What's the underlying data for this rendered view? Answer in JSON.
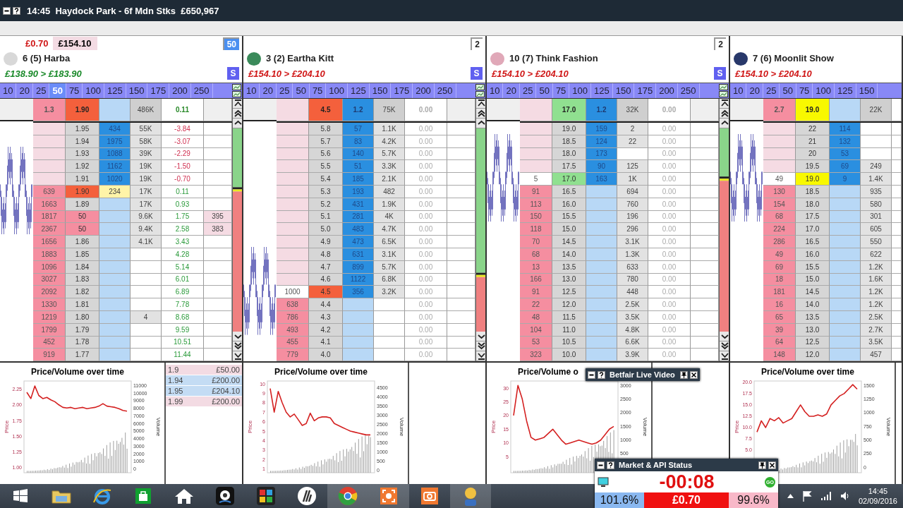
{
  "window": {
    "title": "14:45  Haydock Park - 6f Mdn Stks  £650,967"
  },
  "ladders": [
    {
      "profit": "£0.70",
      "liability": "£154.10",
      "stake_box": {
        "value": "50",
        "selected": true
      },
      "silk": {
        "color": "#d8d8d8"
      },
      "selection": "6  (5) Harba",
      "pl_range": "£138.90 > £183.90",
      "pl_positive": true,
      "s_button": "S",
      "cut": false,
      "highlight": {
        "color": "#f4603c"
      },
      "pl_active": true,
      "stakes": [
        {
          "label": "10",
          "selected": false
        },
        {
          "label": "20",
          "selected": false
        },
        {
          "label": "25",
          "selected": false
        },
        {
          "label": "50",
          "selected": true
        },
        {
          "label": "75",
          "selected": false
        },
        {
          "label": "100",
          "selected": false
        },
        {
          "label": "125",
          "selected": false
        },
        {
          "label": "150",
          "selected": false
        },
        {
          "label": "175",
          "selected": false
        },
        {
          "label": "200",
          "selected": false
        },
        {
          "label": "250",
          "selected": false
        }
      ],
      "summary": {
        "lay": "1.3",
        "ltp": "1.90",
        "traded": "486K",
        "pl": "0.11"
      },
      "rows": [
        {
          "kind": "back",
          "price": "1.95",
          "back": "434",
          "traded": "55K",
          "pl": "-3.84"
        },
        {
          "kind": "back",
          "price": "1.94",
          "back": "1975",
          "traded": "58K",
          "pl": "-3.07"
        },
        {
          "kind": "back",
          "price": "1.93",
          "back": "1088",
          "traded": "39K",
          "pl": "-2.29"
        },
        {
          "kind": "back",
          "price": "1.92",
          "back": "1162",
          "traded": "19K",
          "pl": "-1.50"
        },
        {
          "kind": "back",
          "price": "1.91",
          "back": "1020",
          "traded": "19K",
          "pl": "-0.70"
        },
        {
          "kind": "lay",
          "ltp": true,
          "hovered": true,
          "lay": "639",
          "price": "1.90",
          "back": "234",
          "traded": "17K",
          "pl": "0.11"
        },
        {
          "kind": "lay",
          "lay": "1663",
          "price": "1.89",
          "traded": "17K",
          "pl": "0.93"
        },
        {
          "kind": "lay",
          "order": true,
          "lay": "1817",
          "price": "50",
          "traded": "9.6K",
          "pl": "1.75",
          "extra": "395"
        },
        {
          "kind": "lay",
          "order": true,
          "lay": "2367",
          "price": "50",
          "traded": "9.4K",
          "pl": "2.58",
          "extra": "383"
        },
        {
          "kind": "lay",
          "lay": "1656",
          "price": "1.86",
          "traded": "4.1K",
          "pl": "3.43"
        },
        {
          "kind": "lay",
          "lay": "1883",
          "price": "1.85",
          "pl": "4.28"
        },
        {
          "kind": "lay",
          "lay": "1096",
          "price": "1.84",
          "pl": "5.14"
        },
        {
          "kind": "lay",
          "lay": "3027",
          "price": "1.83",
          "pl": "6.01"
        },
        {
          "kind": "lay",
          "lay": "2092",
          "price": "1.82",
          "pl": "6.89"
        },
        {
          "kind": "lay",
          "lay": "1330",
          "price": "1.81",
          "pl": "7.78"
        },
        {
          "kind": "lay",
          "lay": "1219",
          "price": "1.80",
          "traded": "4",
          "pl": "8.68"
        },
        {
          "kind": "lay",
          "lay": "1799",
          "price": "1.79",
          "pl": "9.59"
        },
        {
          "kind": "lay",
          "lay": "452",
          "price": "1.78",
          "pl": "10.51"
        },
        {
          "kind": "lay",
          "lay": "919",
          "price": "1.77",
          "pl": "11.44"
        }
      ],
      "orders": [
        {
          "price": "1.9",
          "amount": "£50.00",
          "kind": "lay"
        },
        {
          "price": "1.94",
          "amount": "£200.00",
          "kind": "back"
        },
        {
          "price": "1.95",
          "amount": "£204.10",
          "kind": "back"
        },
        {
          "price": "1.99",
          "amount": "£200.00",
          "kind": "lay"
        }
      ],
      "chart_data": {
        "type": "line",
        "title": "Price/Volume over time",
        "y2label": "Volume",
        "ylim": [
          0.92,
          2.38
        ],
        "yticks": [
          {
            "value": 1,
            "label": "1.00"
          },
          {
            "value": 1.25,
            "label": "1.25"
          },
          {
            "value": 1.5,
            "label": "1.50"
          },
          {
            "value": 1.75,
            "label": "1.75"
          },
          {
            "value": 2,
            "label": "2.00"
          },
          {
            "value": 2.25,
            "label": "2.25"
          }
        ],
        "y2lim": [
          -500,
          11600
        ],
        "y2ticks": [
          0,
          1000,
          2000,
          3000,
          4000,
          5000,
          6000,
          7000,
          8000,
          9000,
          10000,
          11000
        ],
        "series": [
          {
            "name": "Price",
            "color": "#d42020",
            "values": [
              2.2,
              2.1,
              2.3,
              2.15,
              2.1,
              2.12,
              2.08,
              2.05,
              2.0,
              1.96,
              1.95,
              1.96,
              1.94,
              1.95,
              1.96,
              1.94,
              1.95,
              1.96,
              1.98,
              2.02,
              1.98,
              1.97,
              1.96,
              1.94,
              1.91,
              1.9
            ]
          }
        ]
      }
    },
    {
      "stake_box": {
        "value": "2",
        "selected": false
      },
      "silk": {
        "color": "#3a8a5a"
      },
      "selection": "3  (2) Eartha Kitt",
      "pl_range": "£154.10 > £204.10",
      "pl_positive": false,
      "s_button": "S",
      "cut": false,
      "highlight": {
        "color": "#f4603c"
      },
      "pl_active": false,
      "stakes": [
        {
          "label": "10",
          "selected": false
        },
        {
          "label": "20",
          "selected": false
        },
        {
          "label": "25",
          "selected": false
        },
        {
          "label": "50",
          "selected": false
        },
        {
          "label": "75",
          "selected": false
        },
        {
          "label": "100",
          "selected": false
        },
        {
          "label": "125",
          "selected": false
        },
        {
          "label": "150",
          "selected": false
        },
        {
          "label": "175",
          "selected": false
        },
        {
          "label": "200",
          "selected": false
        },
        {
          "label": "250",
          "selected": false
        }
      ],
      "summary": {
        "ltp": "4.5",
        "back": "1.2",
        "traded": "75K",
        "pl": "0.00"
      },
      "rows": [
        {
          "kind": "back",
          "price": "5.8",
          "back": "57",
          "traded": "1.1K",
          "pl": "0.00"
        },
        {
          "kind": "back",
          "price": "5.7",
          "back": "83",
          "traded": "4.2K",
          "pl": "0.00"
        },
        {
          "kind": "back",
          "price": "5.6",
          "back": "140",
          "traded": "5.7K",
          "pl": "0.00"
        },
        {
          "kind": "back",
          "price": "5.5",
          "back": "51",
          "traded": "3.3K",
          "pl": "0.00"
        },
        {
          "kind": "back",
          "price": "5.4",
          "back": "185",
          "traded": "2.1K",
          "pl": "0.00"
        },
        {
          "kind": "back",
          "price": "5.3",
          "back": "193",
          "traded": "482",
          "pl": "0.00"
        },
        {
          "kind": "back",
          "price": "5.2",
          "back": "431",
          "traded": "1.9K",
          "pl": "0.00"
        },
        {
          "kind": "back",
          "price": "5.1",
          "back": "281",
          "traded": "4K",
          "pl": "0.00"
        },
        {
          "kind": "back",
          "price": "5.0",
          "back": "483",
          "traded": "4.7K",
          "pl": "0.00"
        },
        {
          "kind": "back",
          "price": "4.9",
          "back": "473",
          "traded": "6.5K",
          "pl": "0.00"
        },
        {
          "kind": "back",
          "price": "4.8",
          "back": "631",
          "traded": "3.1K",
          "pl": "0.00"
        },
        {
          "kind": "back",
          "price": "4.7",
          "back": "899",
          "traded": "5.7K",
          "pl": "0.00"
        },
        {
          "kind": "back",
          "price": "4.6",
          "back": "1122",
          "traded": "6.8K",
          "pl": "0.00"
        },
        {
          "kind": "ltp",
          "ltp": true,
          "lay": "1000",
          "price": "4.5",
          "back": "356",
          "traded": "3.2K",
          "pl": "0.00"
        },
        {
          "kind": "lay",
          "lay": "638",
          "price": "4.4",
          "pl": "0.00"
        },
        {
          "kind": "lay",
          "lay": "786",
          "price": "4.3",
          "pl": "0.00"
        },
        {
          "kind": "lay",
          "lay": "493",
          "price": "4.2",
          "pl": "0.00"
        },
        {
          "kind": "lay",
          "lay": "455",
          "price": "4.1",
          "pl": "0.00"
        },
        {
          "kind": "lay",
          "lay": "779",
          "price": "4.0",
          "pl": "0.00"
        }
      ],
      "chart_data": {
        "type": "line",
        "title": "Price/Volume over time",
        "y2label": "Volume",
        "ylim": [
          0.6,
          10.3
        ],
        "yticks": [
          1,
          2,
          3,
          4,
          5,
          6,
          7,
          8,
          9,
          10
        ],
        "y2lim": [
          -150,
          4850
        ],
        "y2ticks": [
          0,
          500,
          1000,
          1500,
          2000,
          2500,
          3000,
          3500,
          4000,
          4500
        ],
        "series": [
          {
            "name": "Price",
            "color": "#d42020",
            "values": [
              9.5,
              7,
              9.2,
              8,
              7,
              6.5,
              6.8,
              6.2,
              5.6,
              5.8,
              6.9,
              6.1,
              6.4,
              6.5,
              6.5,
              6.4,
              5.8,
              5.6,
              5.4,
              5.2,
              5,
              4.9,
              4.8,
              4.7,
              4.6,
              4.6
            ]
          }
        ]
      }
    },
    {
      "stake_box": {
        "value": "2",
        "selected": false
      },
      "silk": {
        "color": "#e0a8b8"
      },
      "selection": "10  (7) Think Fashion",
      "pl_range": "£154.10 > £204.10",
      "pl_positive": false,
      "s_button": "S",
      "cut": false,
      "highlight": {
        "color": "#90e090"
      },
      "pl_active": false,
      "stakes": [
        {
          "label": "10",
          "selected": false
        },
        {
          "label": "20",
          "selected": false
        },
        {
          "label": "25",
          "selected": false
        },
        {
          "label": "50",
          "selected": false
        },
        {
          "label": "75",
          "selected": false
        },
        {
          "label": "100",
          "selected": false
        },
        {
          "label": "125",
          "selected": false
        },
        {
          "label": "150",
          "selected": false
        },
        {
          "label": "175",
          "selected": false
        },
        {
          "label": "200",
          "selected": false
        },
        {
          "label": "250",
          "selected": false
        }
      ],
      "summary": {
        "ltp": "17.0",
        "back": "1.2",
        "traded": "32K",
        "pl": "0.00"
      },
      "rows": [
        {
          "kind": "back",
          "price": "19.0",
          "back": "159",
          "traded": "2",
          "pl": "0.00"
        },
        {
          "kind": "back",
          "price": "18.5",
          "back": "124",
          "traded": "22",
          "pl": "0.00"
        },
        {
          "kind": "back",
          "price": "18.0",
          "back": "173",
          "pl": "0.00"
        },
        {
          "kind": "back",
          "price": "17.5",
          "back": "90",
          "traded": "125",
          "pl": "0.00"
        },
        {
          "kind": "ltp",
          "ltp": true,
          "lay": "5",
          "price": "17.0",
          "back": "163",
          "traded": "1K",
          "pl": "0.00"
        },
        {
          "kind": "lay",
          "lay": "91",
          "price": "16.5",
          "traded": "694",
          "pl": "0.00"
        },
        {
          "kind": "lay",
          "lay": "113",
          "price": "16.0",
          "traded": "760",
          "pl": "0.00"
        },
        {
          "kind": "lay",
          "lay": "150",
          "price": "15.5",
          "traded": "196",
          "pl": "0.00"
        },
        {
          "kind": "lay",
          "lay": "118",
          "price": "15.0",
          "traded": "296",
          "pl": "0.00"
        },
        {
          "kind": "lay",
          "lay": "70",
          "price": "14.5",
          "traded": "3.1K",
          "pl": "0.00"
        },
        {
          "kind": "lay",
          "lay": "68",
          "price": "14.0",
          "traded": "1.3K",
          "pl": "0.00"
        },
        {
          "kind": "lay",
          "lay": "13",
          "price": "13.5",
          "traded": "633",
          "pl": "0.00"
        },
        {
          "kind": "lay",
          "lay": "166",
          "price": "13.0",
          "traded": "780",
          "pl": "0.00"
        },
        {
          "kind": "lay",
          "lay": "91",
          "price": "12.5",
          "traded": "448",
          "pl": "0.00"
        },
        {
          "kind": "lay",
          "lay": "22",
          "price": "12.0",
          "traded": "2.5K",
          "pl": "0.00"
        },
        {
          "kind": "lay",
          "lay": "48",
          "price": "11.5",
          "traded": "3.5K",
          "pl": "0.00"
        },
        {
          "kind": "lay",
          "lay": "104",
          "price": "11.0",
          "traded": "4.8K",
          "pl": "0.00"
        },
        {
          "kind": "lay",
          "lay": "53",
          "price": "10.5",
          "traded": "6.6K",
          "pl": "0.00"
        },
        {
          "kind": "lay",
          "lay": "323",
          "price": "10.0",
          "traded": "3.9K",
          "pl": "0.00"
        }
      ],
      "chart_data": {
        "type": "line",
        "title": "Price/Volume o",
        "y2label": "Volume",
        "ylim": [
          -0.9,
          32.6
        ],
        "yticks": [
          5,
          10,
          15,
          20,
          25,
          30
        ],
        "y2lim": [
          -196,
          3155
        ],
        "y2ticks": [
          500,
          1000,
          1500,
          2000,
          2500,
          3000
        ],
        "series": [
          {
            "name": "Price",
            "color": "#d42020",
            "values": [
              20,
              31,
              26,
              18,
              12,
              11,
              11.5,
              12,
              13.5,
              15,
              13,
              11,
              9.5,
              10,
              10.5,
              11,
              10.5,
              10,
              9.5,
              10,
              11,
              13,
              15,
              16
            ]
          }
        ]
      }
    },
    {
      "silk": {
        "color": "#28386a"
      },
      "selection": "7  (6) Moonlit Show",
      "pl_range": "£154.10 > £204.10",
      "pl_positive": false,
      "cut": true,
      "highlight": {
        "color": "#f8f800"
      },
      "pl_active": false,
      "stakes": [
        {
          "label": "10",
          "selected": false
        },
        {
          "label": "20",
          "selected": false
        },
        {
          "label": "25",
          "selected": false
        },
        {
          "label": "50",
          "selected": false
        },
        {
          "label": "75",
          "selected": false
        },
        {
          "label": "100",
          "selected": false
        },
        {
          "label": "125",
          "selected": false
        },
        {
          "label": "150",
          "selected": false
        }
      ],
      "summary": {
        "lay": "2.7",
        "ltp": "19.0",
        "traded": "22K"
      },
      "rows": [
        {
          "kind": "back",
          "price": "22",
          "back": "114"
        },
        {
          "kind": "back",
          "price": "21",
          "back": "132"
        },
        {
          "kind": "back",
          "price": "20",
          "back": "53"
        },
        {
          "kind": "back",
          "price": "19.5",
          "back": "69",
          "traded": "249"
        },
        {
          "kind": "ltp",
          "ltp": true,
          "lay": "49",
          "price": "19.0",
          "back": "9",
          "traded": "1.4K"
        },
        {
          "kind": "lay",
          "lay": "130",
          "price": "18.5",
          "traded": "935"
        },
        {
          "kind": "lay",
          "lay": "154",
          "price": "18.0",
          "traded": "580"
        },
        {
          "kind": "lay",
          "lay": "68",
          "price": "17.5",
          "traded": "301"
        },
        {
          "kind": "lay",
          "lay": "224",
          "price": "17.0",
          "traded": "605"
        },
        {
          "kind": "lay",
          "lay": "286",
          "price": "16.5",
          "traded": "550"
        },
        {
          "kind": "lay",
          "lay": "49",
          "price": "16.0",
          "traded": "622"
        },
        {
          "kind": "lay",
          "lay": "69",
          "price": "15.5",
          "traded": "1.2K"
        },
        {
          "kind": "lay",
          "lay": "18",
          "price": "15.0",
          "traded": "1.6K"
        },
        {
          "kind": "lay",
          "lay": "181",
          "price": "14.5",
          "traded": "1.2K"
        },
        {
          "kind": "lay",
          "lay": "16",
          "price": "14.0",
          "traded": "1.2K"
        },
        {
          "kind": "lay",
          "lay": "65",
          "price": "13.5",
          "traded": "2.5K"
        },
        {
          "kind": "lay",
          "lay": "39",
          "price": "13.0",
          "traded": "2.7K"
        },
        {
          "kind": "lay",
          "lay": "64",
          "price": "12.5",
          "traded": "3.5K"
        },
        {
          "kind": "lay",
          "lay": "148",
          "price": "12.0",
          "traded": "457"
        }
      ],
      "chart_data": {
        "type": "line",
        "title": "Price/Volume over time",
        "y2label": "Volume",
        "ylim": [
          0,
          20.3
        ],
        "yticks": [
          {
            "value": 5,
            "label": "5.0"
          },
          {
            "value": 7.5,
            "label": "7.5"
          },
          {
            "value": 10,
            "label": "10.0"
          },
          {
            "value": 12.5,
            "label": "12.5"
          },
          {
            "value": 15,
            "label": "15.0"
          },
          {
            "value": 17.5,
            "label": "17.5"
          },
          {
            "value": 20,
            "label": "20.0"
          }
        ],
        "y2lim": [
          -103,
          1578
        ],
        "y2ticks": [
          0,
          250,
          500,
          750,
          1000,
          1250,
          1500
        ],
        "series": [
          {
            "name": "Price",
            "color": "#d42020",
            "values": [
              9,
              11.5,
              10,
              12,
              11.5,
              12.2,
              11,
              11.5,
              12,
              13.5,
              15,
              13.5,
              12.5,
              12.5,
              12.8,
              12.5,
              13,
              15,
              16,
              17,
              17.5,
              18.5,
              19.5,
              18.5
            ]
          }
        ]
      }
    }
  ],
  "video_window": {
    "title": "Betfair Live Video"
  },
  "status_window": {
    "title": "Market & API Status",
    "countdown": "-00:08",
    "go": "GO",
    "back_book": "101.6%",
    "matched": "£0.70",
    "lay_book": "99.6%"
  },
  "taskbar": {
    "time": "14:45",
    "date": "02/09/2016"
  }
}
